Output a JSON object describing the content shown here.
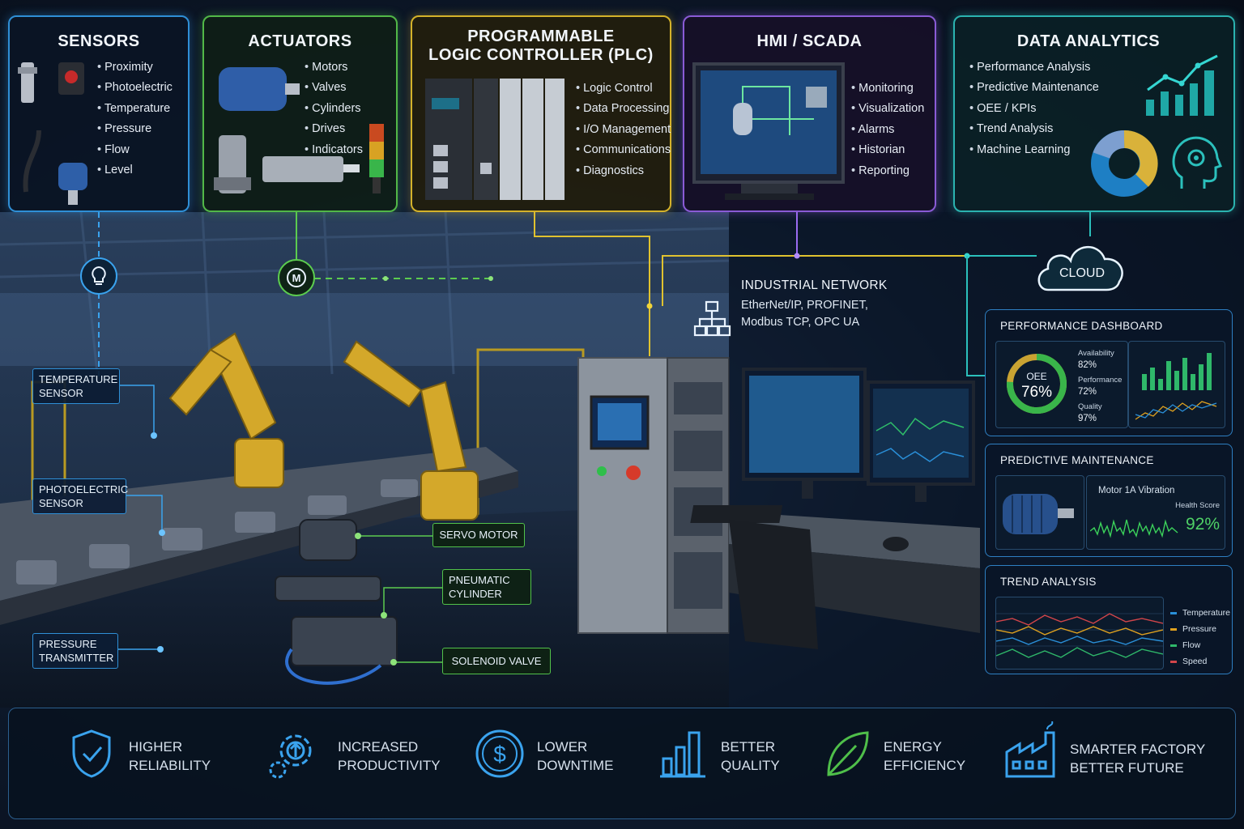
{
  "panels": {
    "sensors": {
      "title": "SENSORS",
      "items": [
        "Proximity",
        "Photoelectric",
        "Temperature",
        "Pressure",
        "Flow",
        "Level"
      ]
    },
    "actuators": {
      "title": "ACTUATORS",
      "items": [
        "Motors",
        "Valves",
        "Cylinders",
        "Drives",
        "Indicators"
      ]
    },
    "plc": {
      "title_line1": "PROGRAMMABLE",
      "title_line2": "LOGIC CONTROLLER (PLC)",
      "items": [
        "Logic Control",
        "Data Processing",
        "I/O Management",
        "Communications",
        "Diagnostics"
      ]
    },
    "hmi": {
      "title": "HMI / SCADA",
      "items": [
        "Monitoring",
        "Visualization",
        "Alarms",
        "Historian",
        "Reporting"
      ]
    },
    "analytics": {
      "title": "DATA ANALYTICS",
      "items": [
        "Performance Analysis",
        "Predictive Maintenance",
        "OEE / KPIs",
        "Trend Analysis",
        "Machine Learning"
      ]
    }
  },
  "network": {
    "title": "INDUSTRIAL NETWORK",
    "line1": "EtherNet/IP, PROFINET,",
    "line2": "Modbus TCP, OPC  UA",
    "cloud": "CLOUD"
  },
  "callouts": {
    "temperature": "TEMPERATURE SENSOR",
    "photoelectric": "PHOTOELECTRIC SENSOR",
    "pressure": "PRESSURE TRANSMITTER",
    "servo": "SERVO MOTOR",
    "pneumatic": "PNEUMATIC CYLINDER",
    "solenoid": "SOLENOID VALVE"
  },
  "dashboard": {
    "title": "PERFORMANCE DASHBOARD",
    "oee_label": "OEE",
    "oee_value": "76%",
    "oee_fraction": 0.76,
    "metrics": [
      {
        "label": "Availability",
        "value": "82%"
      },
      {
        "label": "Performance",
        "value": "72%"
      },
      {
        "label": "Quality",
        "value": "97%"
      }
    ]
  },
  "predictive": {
    "title": "PREDICTIVE MAINTENANCE",
    "chart_label": "Motor 1A Vibration",
    "health_label": "Health Score",
    "health_value": "92%"
  },
  "trend": {
    "title": "TREND ANALYSIS",
    "legend": [
      {
        "name": "Temperature",
        "color": "#2a8fd8"
      },
      {
        "name": "Pressure",
        "color": "#e0a21f"
      },
      {
        "name": "Flow",
        "color": "#2fb86a"
      },
      {
        "name": "Speed",
        "color": "#d2454a"
      }
    ]
  },
  "benefits": [
    {
      "icon": "shield-check-icon",
      "label": "HIGHER\nRELIABILITY"
    },
    {
      "icon": "gear-arrow-icon",
      "label": "INCREASED\nPRODUCTIVITY"
    },
    {
      "icon": "dollar-coin-icon",
      "label": "LOWER\nDOWNTIME"
    },
    {
      "icon": "bar-chart-icon",
      "label": "BETTER\nQUALITY"
    },
    {
      "icon": "leaf-icon",
      "label": "ENERGY\nEFFICIENCY"
    },
    {
      "icon": "factory-icon",
      "label": "SMARTER FACTORY\nBETTER FUTURE"
    }
  ],
  "colors": {
    "sensors": "#2f8fd6",
    "actuators": "#52b848",
    "plc": "#d4b22a",
    "hmi": "#8a5bd6",
    "analytics": "#2bb3b0"
  }
}
